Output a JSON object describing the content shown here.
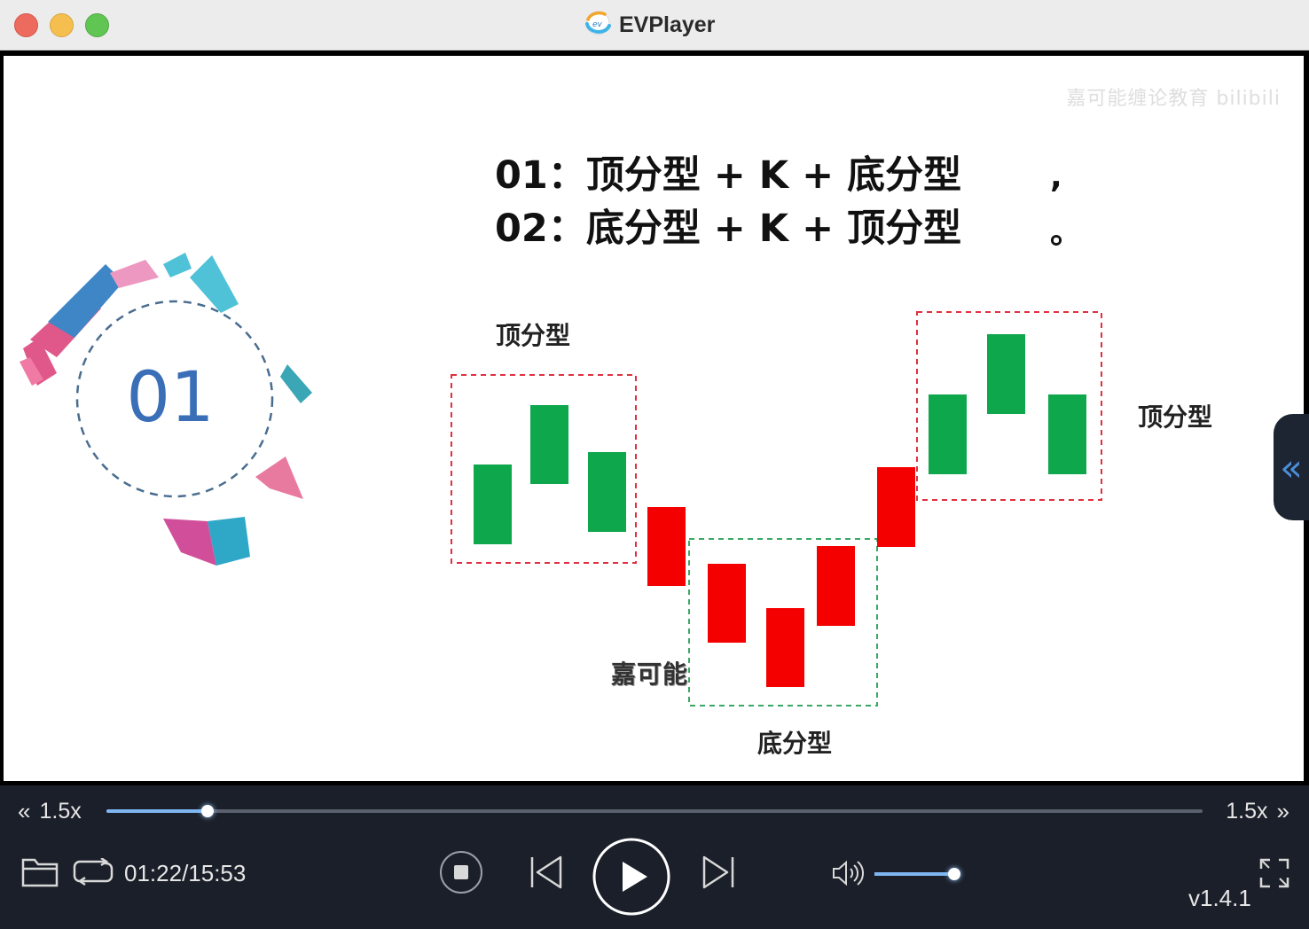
{
  "window": {
    "title": "EVPlayer",
    "app_icon": "ev-logo-icon"
  },
  "video": {
    "watermark": "嘉可能缠论教育 bilibili",
    "badge_number": "01",
    "formula_line1": "01：顶分型 + K + 底分型",
    "formula_line2": "02：底分型 + K + 顶分型",
    "punct1": ",",
    "punct2": "。",
    "label_top_left": "顶分型",
    "label_top_right": "顶分型",
    "label_bottom": "底分型",
    "brand": "嘉可能",
    "candle_colors": {
      "green": "#0ea74b",
      "red": "#f50000",
      "red_dash": "#e0303f",
      "green_dash": "#3aa864"
    },
    "side_handle_icon": "double-chevron-left-icon"
  },
  "controls": {
    "speed_left": "1.5x",
    "speed_right": "1.5x",
    "seek_progress": 0.092,
    "time": "01:22/15:53",
    "volume": 1.0,
    "version": "v1.4.1",
    "icons": {
      "speed_down": "double-chevron-left-icon",
      "speed_up": "double-chevron-right-icon",
      "open": "folder-icon",
      "loop": "loop-icon",
      "stop": "stop-icon",
      "prev": "skip-previous-icon",
      "play": "play-icon",
      "next": "skip-next-icon",
      "volume": "volume-icon",
      "fullscreen": "fullscreen-icon"
    },
    "accent": "#7fb6f2"
  }
}
